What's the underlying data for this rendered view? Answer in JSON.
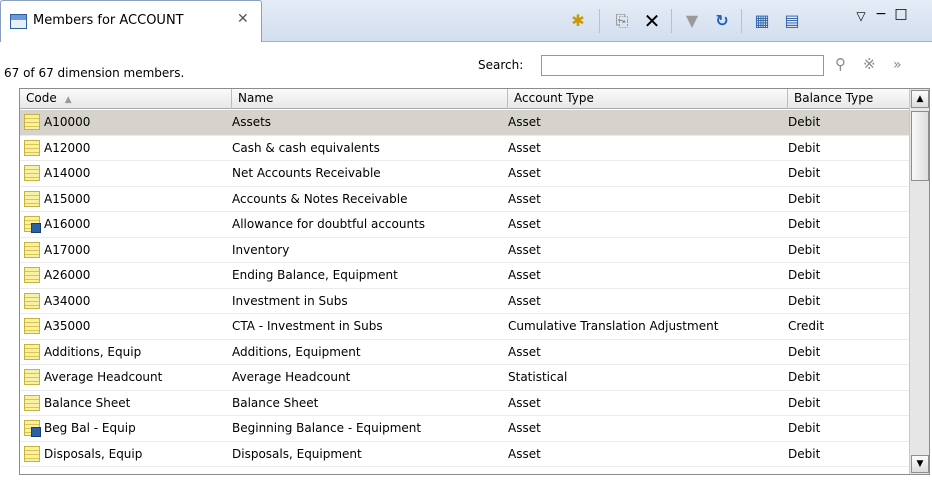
{
  "tab": {
    "title": "Members for ACCOUNT",
    "close_glyph": "✕"
  },
  "toolbar": {
    "new_glyph": "✱",
    "copy_glyph": "⎘",
    "delete_glyph": "✕",
    "filter_glyph": "▼",
    "refresh_glyph": "↻",
    "grid_glyph": "▦",
    "columns_glyph": "▤",
    "view_menu_glyph": "▽",
    "minimize_glyph": "−",
    "maximize_glyph": "□"
  },
  "status": "67 of 67 dimension members.",
  "search": {
    "label": "Search:",
    "value": "",
    "search_glyph": "⚲",
    "clear_glyph": "※",
    "more_glyph": "»"
  },
  "table": {
    "headers": [
      "Code",
      "Name",
      "Account Type",
      "Balance Type"
    ],
    "sort_glyph": "▲",
    "rows": [
      {
        "code": "A10000",
        "name": "Assets",
        "type": "Asset",
        "balance": "Debit",
        "icon": "member-icon"
      },
      {
        "code": "A12000",
        "name": "Cash & cash equivalents",
        "type": "Asset",
        "balance": "Debit",
        "icon": "member-icon"
      },
      {
        "code": "A14000",
        "name": "Net Accounts Receivable",
        "type": "Asset",
        "balance": "Debit",
        "icon": "member-icon"
      },
      {
        "code": "A15000",
        "name": "Accounts & Notes Receivable",
        "type": "Asset",
        "balance": "Debit",
        "icon": "member-icon"
      },
      {
        "code": "A16000",
        "name": "Allowance for doubtful accounts",
        "type": "Asset",
        "balance": "Debit",
        "icon": "calculated-member-icon"
      },
      {
        "code": "A17000",
        "name": "Inventory",
        "type": "Asset",
        "balance": "Debit",
        "icon": "member-icon"
      },
      {
        "code": "A26000",
        "name": "Ending Balance, Equipment",
        "type": "Asset",
        "balance": "Debit",
        "icon": "member-icon"
      },
      {
        "code": "A34000",
        "name": "Investment in Subs",
        "type": "Asset",
        "balance": "Debit",
        "icon": "member-icon"
      },
      {
        "code": "A35000",
        "name": "CTA - Investment in Subs",
        "type": "Cumulative Translation Adjustment",
        "balance": "Credit",
        "icon": "member-icon"
      },
      {
        "code": "Additions, Equip",
        "name": "Additions, Equipment",
        "type": "Asset",
        "balance": "Debit",
        "icon": "member-icon"
      },
      {
        "code": "Average Headcount",
        "name": "Average Headcount",
        "type": "Statistical",
        "balance": "Debit",
        "icon": "member-icon"
      },
      {
        "code": "Balance Sheet",
        "name": "Balance Sheet",
        "type": "Asset",
        "balance": "Debit",
        "icon": "member-icon"
      },
      {
        "code": "Beg Bal - Equip",
        "name": "Beginning Balance - Equipment",
        "type": "Asset",
        "balance": "Debit",
        "icon": "calculated-member-icon"
      },
      {
        "code": "Disposals, Equip",
        "name": "Disposals, Equipment",
        "type": "Asset",
        "balance": "Debit",
        "icon": "member-icon"
      }
    ]
  },
  "scrollbar": {
    "up_glyph": "▲",
    "down_glyph": "▼"
  }
}
